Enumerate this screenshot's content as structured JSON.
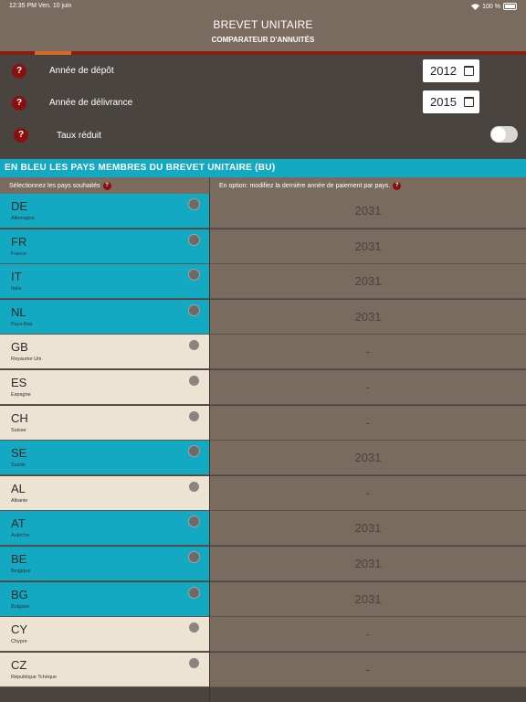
{
  "status_bar": {
    "time_date": "12:35 PM  Ven. 10 juin",
    "battery": "100 %"
  },
  "header": {
    "title": "BREVET UNITAIRE",
    "subtitle": "COMPARATEUR D'ANNUITÉS"
  },
  "settings": {
    "help_symbol": "?",
    "filing_year_label": "Année de dépôt",
    "filing_year_value": "2012",
    "grant_year_label": "Année de délivrance",
    "grant_year_value": "2015",
    "reduced_rate_label": "Taux réduit",
    "reduced_rate_on": false
  },
  "banner": "EN BLEU LES PAYS MEMBRES DU BREVET UNITAIRE (BU)",
  "columns": {
    "select_countries": "Sélectionnez les pays souhaités",
    "option_last_year": "En option: modifiez la dernière année de paiement par pays."
  },
  "colors": {
    "member_blue": "#14a9c2",
    "nonmember_beige": "#ece3d3",
    "header_brown": "#7a6b5f",
    "help_red": "#8a1010"
  },
  "countries": [
    {
      "code": "DE",
      "name": "Allemagne",
      "member": true,
      "last_year": "2031"
    },
    {
      "code": "FR",
      "name": "France",
      "member": true,
      "last_year": "2031"
    },
    {
      "code": "IT",
      "name": "Italie",
      "member": true,
      "last_year": "2031"
    },
    {
      "code": "NL",
      "name": "Pays-Bas",
      "member": true,
      "last_year": "2031"
    },
    {
      "code": "GB",
      "name": "Royaume Uni",
      "member": false,
      "last_year": "-"
    },
    {
      "code": "ES",
      "name": "Espagne",
      "member": false,
      "last_year": "-"
    },
    {
      "code": "CH",
      "name": "Suisse",
      "member": false,
      "last_year": "-"
    },
    {
      "code": "SE",
      "name": "Suède",
      "member": true,
      "last_year": "2031"
    },
    {
      "code": "AL",
      "name": "Albanie",
      "member": false,
      "last_year": "-"
    },
    {
      "code": "AT",
      "name": "Autriche",
      "member": true,
      "last_year": "2031"
    },
    {
      "code": "BE",
      "name": "Belgique",
      "member": true,
      "last_year": "2031"
    },
    {
      "code": "BG",
      "name": "Bulgarie",
      "member": true,
      "last_year": "2031"
    },
    {
      "code": "CY",
      "name": "Chypre",
      "member": false,
      "last_year": "-"
    },
    {
      "code": "CZ",
      "name": "République Tchèque",
      "member": false,
      "last_year": "-"
    }
  ]
}
